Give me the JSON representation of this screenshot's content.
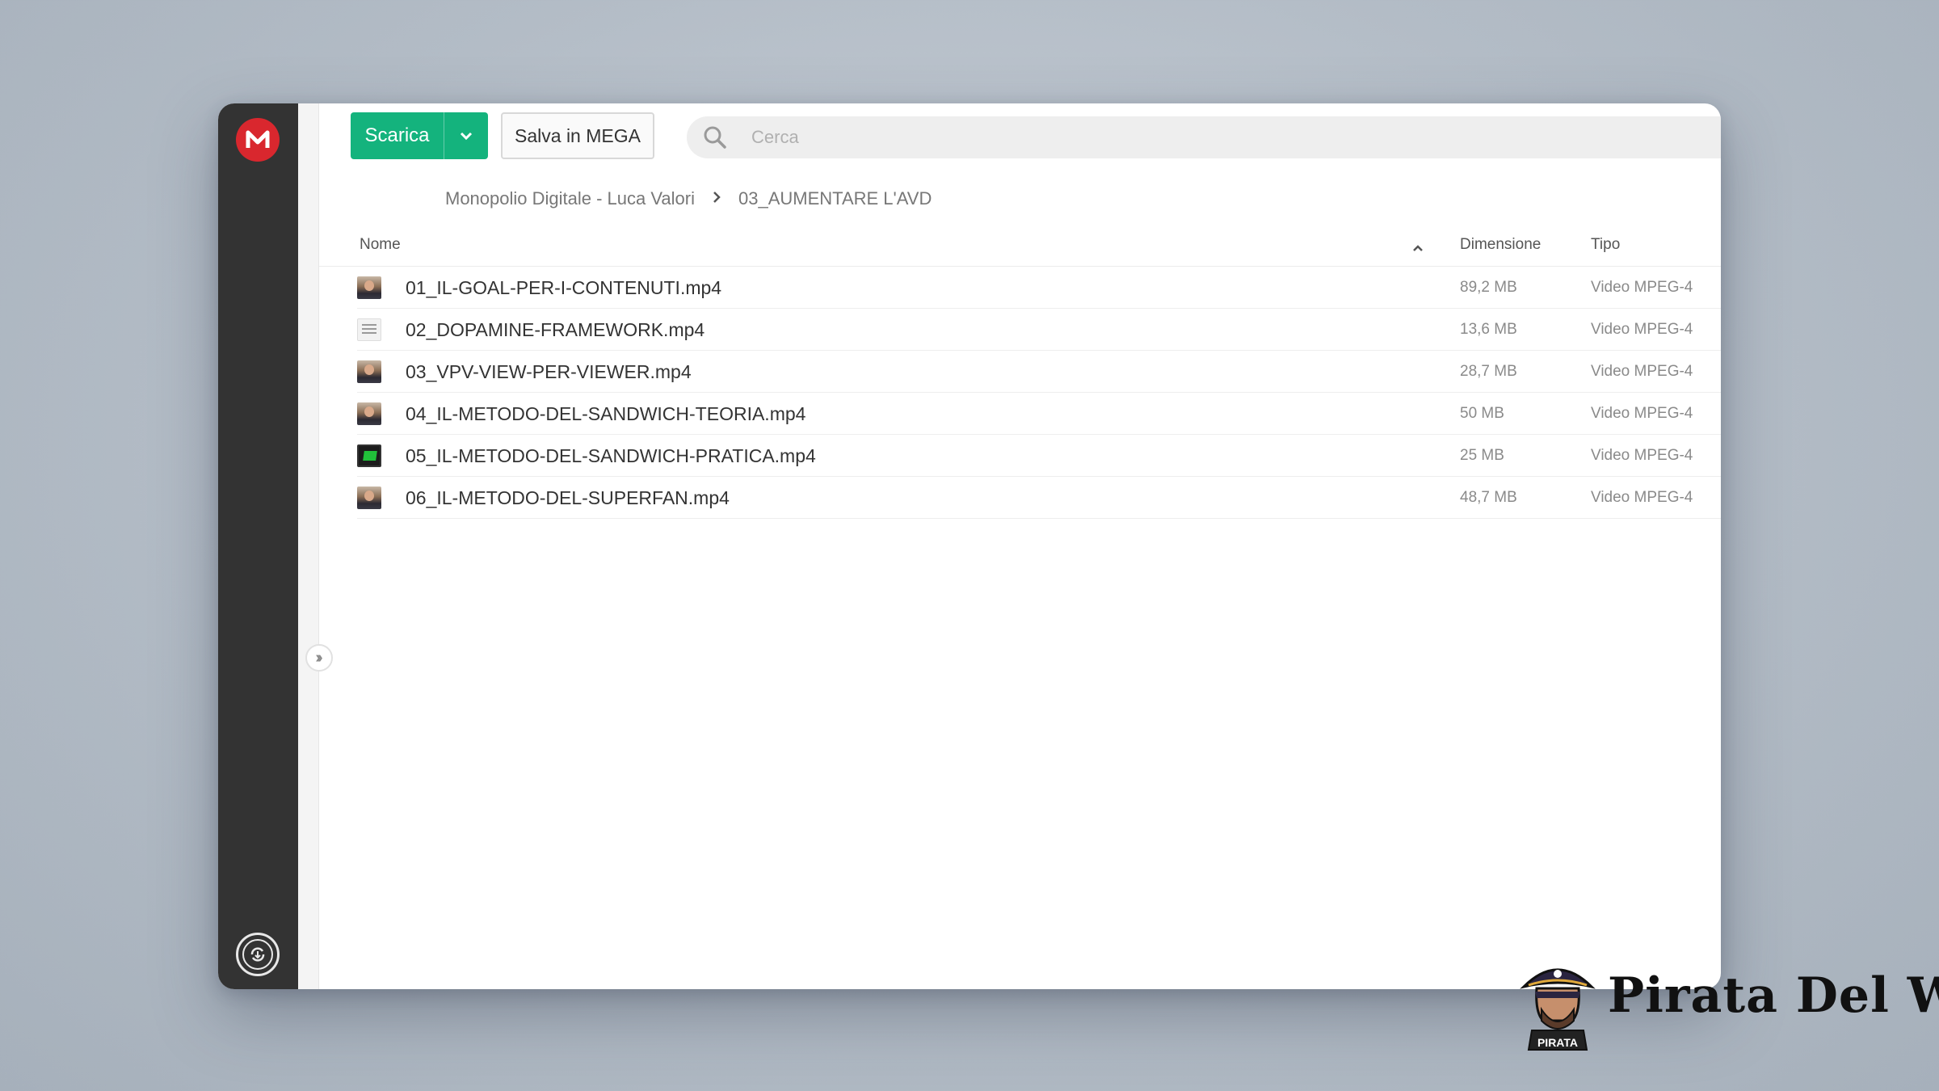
{
  "toolbar": {
    "download_label": "Scarica",
    "save_label": "Salva in MEGA"
  },
  "search": {
    "placeholder": "Cerca"
  },
  "breadcrumb": [
    "Monopolio Digitale - Luca Valori",
    "03_AUMENTARE L'AVD"
  ],
  "table": {
    "columns": {
      "name": "Nome",
      "size": "Dimensione",
      "type": "Tipo"
    },
    "sort": "name-ascending",
    "rows": [
      {
        "name": "01_IL-GOAL-PER-I-CONTENUTI.mp4",
        "size": "89,2 MB",
        "type": "Video MPEG-4",
        "thumb": "person"
      },
      {
        "name": "02_DOPAMINE-FRAMEWORK.mp4",
        "size": "13,6 MB",
        "type": "Video MPEG-4",
        "thumb": "doc"
      },
      {
        "name": "03_VPV-VIEW-PER-VIEWER.mp4",
        "size": "28,7 MB",
        "type": "Video MPEG-4",
        "thumb": "person"
      },
      {
        "name": "04_IL-METODO-DEL-SANDWICH-TEORIA.mp4",
        "size": "50 MB",
        "type": "Video MPEG-4",
        "thumb": "person"
      },
      {
        "name": "05_IL-METODO-DEL-SANDWICH-PRATICA.mp4",
        "size": "25 MB",
        "type": "Video MPEG-4",
        "thumb": "screen"
      },
      {
        "name": "06_IL-METODO-DEL-SUPERFAN.mp4",
        "size": "48,7 MB",
        "type": "Video MPEG-4",
        "thumb": "person"
      }
    ]
  },
  "icons": {
    "logo": "mega-logo-icon",
    "sync": "sync-icon",
    "expand": "double-chevron-right-icon",
    "search": "search-icon",
    "dropdown": "chevron-down-icon",
    "sort": "chevron-up-icon"
  },
  "colors": {
    "accent": "#14b37d",
    "brand": "#d9272e",
    "sidebar": "#333333"
  },
  "watermark": {
    "text": "Pirata Del Web",
    "badge": "PIRATA"
  }
}
